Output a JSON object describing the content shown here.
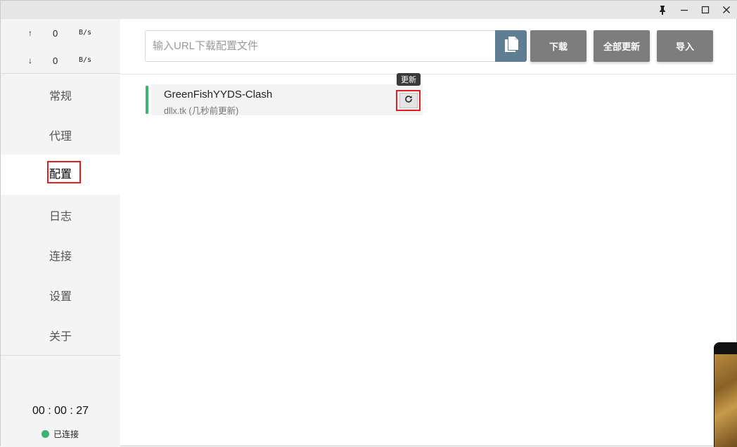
{
  "window_controls": {
    "pin": "pin-icon",
    "minimize": "minimize-icon",
    "maximize": "maximize-icon",
    "close": "close-icon"
  },
  "traffic": {
    "upload": {
      "arrow": "↑",
      "value": "0",
      "unit": "B/s"
    },
    "download": {
      "arrow": "↓",
      "value": "0",
      "unit": "B/s"
    }
  },
  "nav": {
    "items": [
      {
        "label": "常规"
      },
      {
        "label": "代理"
      },
      {
        "label": "配置"
      },
      {
        "label": "日志"
      },
      {
        "label": "连接"
      },
      {
        "label": "设置"
      },
      {
        "label": "关于"
      }
    ],
    "active_index": 2
  },
  "footer": {
    "uptime": "00 : 00 : 27",
    "status_label": "已连接",
    "status_color": "#3cb371"
  },
  "toolbar": {
    "url_placeholder": "输入URL下载配置文件",
    "paste_icon": "clipboard-paste-icon",
    "download_label": "下载",
    "update_all_label": "全部更新",
    "import_label": "导入"
  },
  "profiles": [
    {
      "name": "GreenFishYYDS-Clash",
      "source": "dllx.tk (几秒前更新)",
      "active_color": "#3cb371",
      "refresh_tooltip": "更新",
      "refresh_icon": "refresh-icon"
    }
  ]
}
